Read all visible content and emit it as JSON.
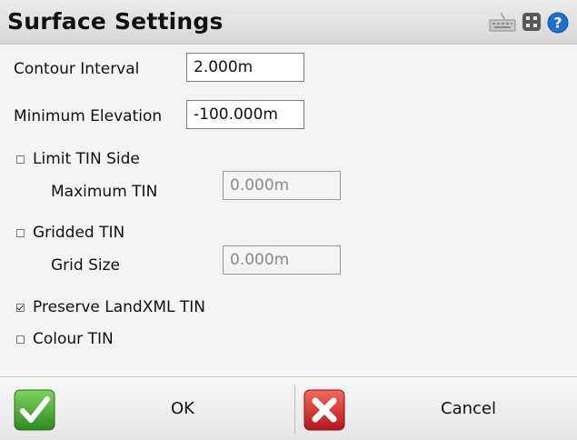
{
  "header": {
    "title": "Surface Settings"
  },
  "icons": {
    "keyboard": "keyboard-icon",
    "apps": "apps-grid-icon",
    "help": "help-icon"
  },
  "fields": {
    "contour_interval": {
      "label": "Contour Interval",
      "value": "2.000m"
    },
    "minimum_elevation": {
      "label": "Minimum Elevation",
      "value": "-100.000m"
    }
  },
  "options": {
    "limit_tin_side": {
      "label": "Limit TIN Side",
      "checked": false
    },
    "maximum_tin": {
      "label": "Maximum TIN",
      "value": "0.000m",
      "disabled": true
    },
    "gridded_tin": {
      "label": "Gridded TIN",
      "checked": false
    },
    "grid_size": {
      "label": "Grid Size",
      "value": "0.000m",
      "disabled": true
    },
    "preserve_landxml_tin": {
      "label": "Preserve LandXML TIN",
      "checked": true
    },
    "colour_tin": {
      "label": "Colour TIN",
      "checked": false
    }
  },
  "buttons": {
    "ok": "OK",
    "cancel": "Cancel"
  },
  "colors": {
    "ok_green": "#3aa02a",
    "cancel_red": "#d8262a",
    "help_blue": "#1f6fd0"
  }
}
